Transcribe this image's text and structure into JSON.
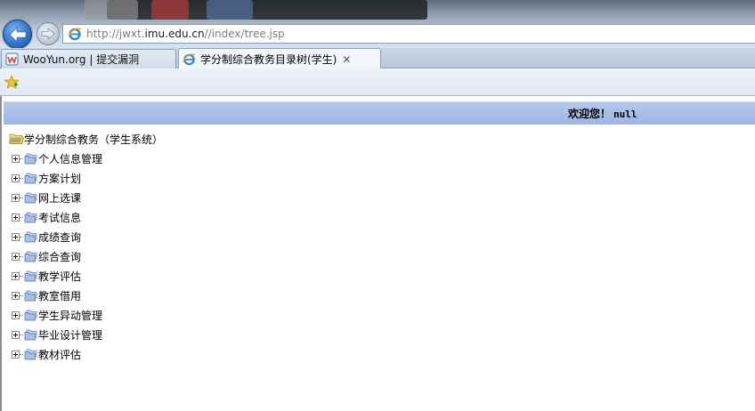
{
  "browser": {
    "url_prefix": "http://jwxt.",
    "url_domain": "imu.edu.cn",
    "url_suffix": "//index/tree.jsp",
    "tabs": [
      {
        "label": "WooYun.org | 提交漏洞",
        "active": false
      },
      {
        "label": "学分制综合教务目录树(学生)",
        "active": true,
        "close": "✕"
      }
    ]
  },
  "page": {
    "welcome_text": "欢迎您！",
    "username": "null",
    "tree": {
      "root_label": "学分制综合教务（学生系统）",
      "items": [
        {
          "label": "个人信息管理"
        },
        {
          "label": "方案计划"
        },
        {
          "label": "网上选课"
        },
        {
          "label": "考试信息"
        },
        {
          "label": "成绩查询"
        },
        {
          "label": "综合查询"
        },
        {
          "label": "教学评估"
        },
        {
          "label": "教室借用"
        },
        {
          "label": "学生异动管理"
        },
        {
          "label": "毕业设计管理"
        },
        {
          "label": "教材评估"
        }
      ]
    }
  },
  "colors": {
    "header_band": "#a8bce8",
    "folder": "#8aa6d6",
    "root_folder": "#f2d26b"
  },
  "icons": {
    "back": "back-arrow-icon",
    "forward": "forward-arrow-icon",
    "browser": "internet-explorer-icon",
    "favorites": "favorites-star-icon",
    "tree_expand": "plus-box-icon",
    "tree_node": "folder-stack-icon",
    "tree_root": "open-folder-icon"
  }
}
